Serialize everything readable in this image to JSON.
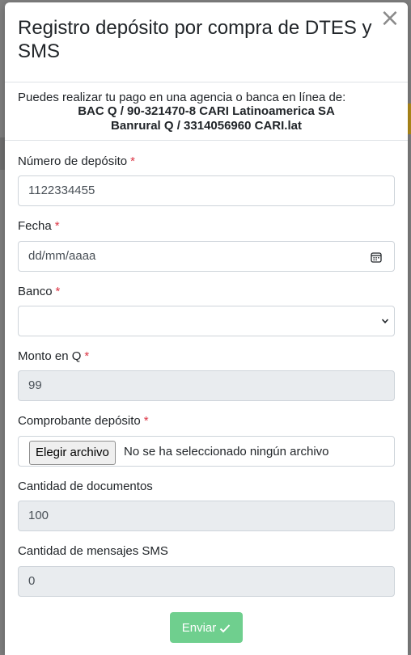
{
  "modal": {
    "title": "Registro depósito por compra de DTES y SMS",
    "close_glyph": "×"
  },
  "payment_info": {
    "intro": "Puedes realizar tu pago en una agencia o banca en línea de:",
    "accounts": [
      "BAC Q / 90-321470-8 CARI Latinoamerica SA",
      "Banrural Q / 3314056960 CARI.lat"
    ]
  },
  "form": {
    "required_marker": "*",
    "deposit_number": {
      "label": "Número de depósito",
      "value": "1122334455"
    },
    "date": {
      "label": "Fecha",
      "placeholder": "dd/mm/aaaa",
      "icon": "calendar-icon"
    },
    "bank": {
      "label": "Banco",
      "value": "",
      "icon": "chevron-down-icon"
    },
    "amount": {
      "label": "Monto en Q",
      "value": "99"
    },
    "receipt": {
      "label": "Comprobante depósito",
      "button_label": "Elegir archivo",
      "status": "No se ha seleccionado ningún archivo"
    },
    "documents_qty": {
      "label": "Cantidad de documentos",
      "value": "100"
    },
    "sms_qty": {
      "label": "Cantidad de mensajes SMS",
      "value": "0"
    },
    "submit": {
      "label": "Enviar",
      "icon": "check-icon"
    }
  },
  "colors": {
    "required": "#dc3545",
    "submit_bg": "#6fcf8e",
    "disabled_bg": "#e9ecef",
    "overlay": "#7f7f7f"
  }
}
